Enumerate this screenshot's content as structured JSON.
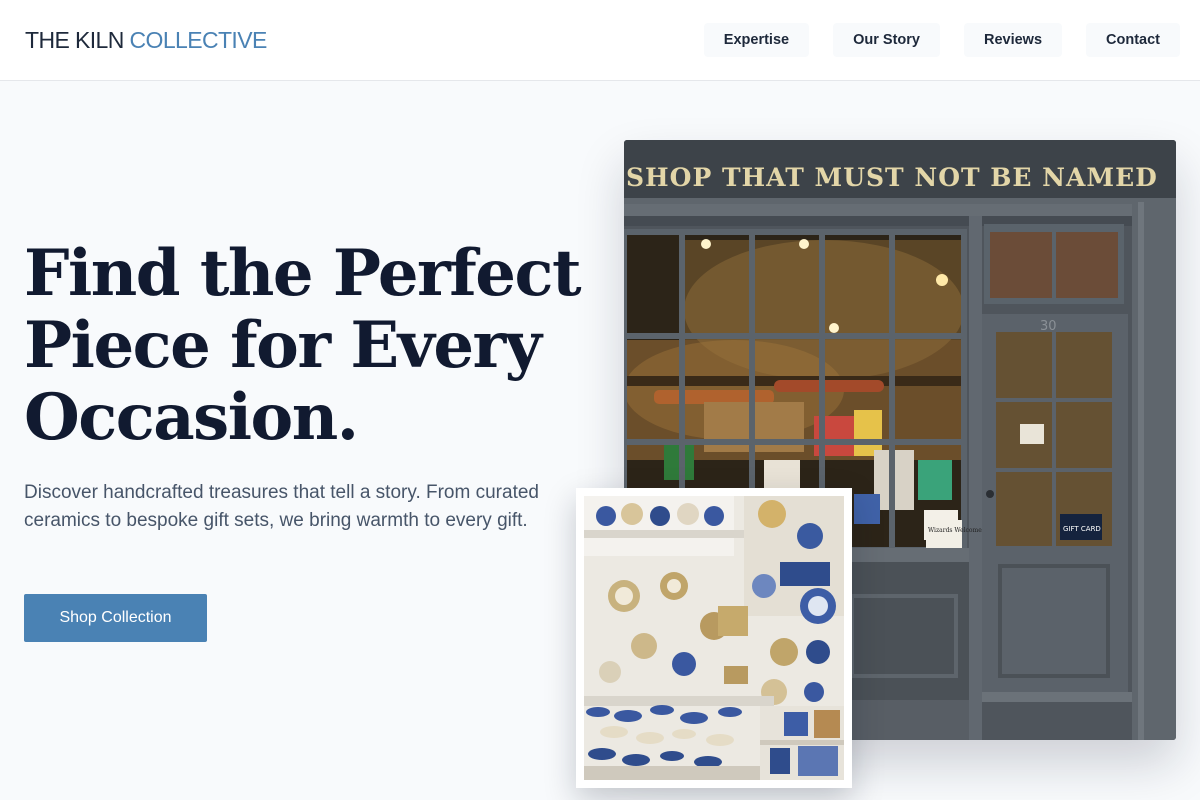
{
  "header": {
    "logo": {
      "part1": "THE KILN",
      "part2": "COLLECTIVE"
    },
    "nav": [
      {
        "label": "Expertise"
      },
      {
        "label": "Our Story"
      },
      {
        "label": "Reviews"
      },
      {
        "label": "Contact"
      }
    ]
  },
  "hero": {
    "title": "Find the Perfect Piece for Every Occasion.",
    "subtitle": "Discover handcrafted treasures that tell a story. From curated ceramics to bespoke gift sets, we bring warmth to every gift.",
    "cta_label": "Shop Collection"
  },
  "images": {
    "shopfront": {
      "sign_text": "SHOP THAT MUST NOT BE NAMED",
      "door_number": "30",
      "door_sign": "Wizards Welcome",
      "card_text": "GIFT CARD"
    },
    "pottery": {}
  },
  "colors": {
    "accent": "#4a82b4",
    "heading": "#111a30",
    "body_text": "#475569",
    "background": "#f8fafc",
    "header_bg": "#ffffff"
  }
}
